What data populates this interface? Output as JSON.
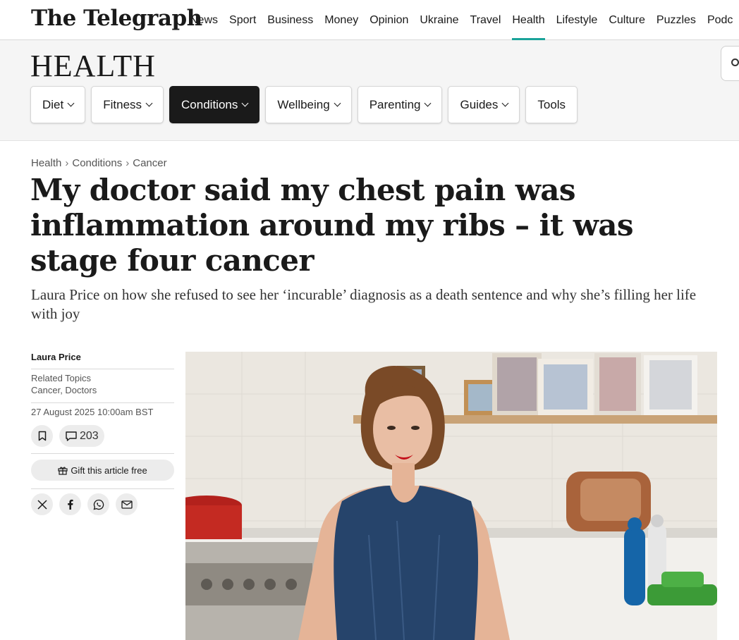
{
  "brand": {
    "logo": "The Telegraph"
  },
  "nav": {
    "items": [
      "News",
      "Sport",
      "Business",
      "Money",
      "Opinion",
      "Ukraine",
      "Travel",
      "Health",
      "Lifestyle",
      "Culture",
      "Puzzles",
      "Podc"
    ],
    "active": "Health",
    "accent_color": "#1aa39a"
  },
  "section": {
    "title": "HEALTH",
    "search_icon": "search-icon",
    "pills": [
      "Diet",
      "Fitness",
      "Conditions",
      "Wellbeing",
      "Parenting",
      "Guides",
      "Tools"
    ],
    "active_pill": "Conditions"
  },
  "breadcrumb": [
    "Health",
    "Conditions",
    "Cancer"
  ],
  "article": {
    "headline": "My doctor said my chest pain was inflammation around my ribs – it was stage four cancer",
    "standfirst": "Laura Price on how she refused to see her ‘incurable’ diagnosis as a death sentence and why she’s filling her life with joy",
    "author": "Laura Price",
    "related_label": "Related Topics",
    "related_topics": "Cancer, Doctors",
    "date": "27 August 2025 10:00am BST",
    "comment_count": "203",
    "gift_label": "Gift this article free",
    "share_icons": [
      "x-icon",
      "facebook-icon",
      "whatsapp-icon",
      "email-icon"
    ]
  }
}
